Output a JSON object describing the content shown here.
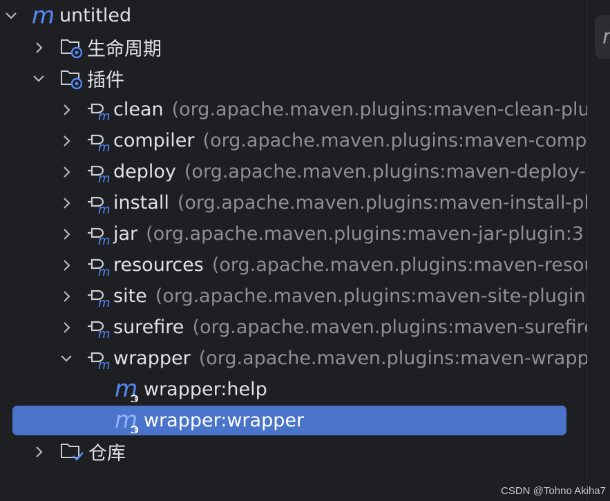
{
  "tree": {
    "root": {
      "label": "untitled",
      "expanded": true,
      "icon": "maven-module-icon"
    },
    "lifecycle": {
      "label": "生命周期",
      "expanded": false,
      "icon": "folder-settings-icon"
    },
    "plugins": {
      "label": "插件",
      "expanded": true,
      "icon": "folder-settings-icon",
      "items": [
        {
          "name": "clean",
          "coord": "(org.apache.maven.plugins:maven-clean-plugin"
        },
        {
          "name": "compiler",
          "coord": "(org.apache.maven.plugins:maven-compiler-plugin"
        },
        {
          "name": "deploy",
          "coord": "(org.apache.maven.plugins:maven-deploy-plugin"
        },
        {
          "name": "install",
          "coord": "(org.apache.maven.plugins:maven-install-plugin"
        },
        {
          "name": "jar",
          "coord": "(org.apache.maven.plugins:maven-jar-plugin:3"
        },
        {
          "name": "resources",
          "coord": "(org.apache.maven.plugins:maven-resources-plugin"
        },
        {
          "name": "site",
          "coord": "(org.apache.maven.plugins:maven-site-plugin"
        },
        {
          "name": "surefire",
          "coord": "(org.apache.maven.plugins:maven-surefire-plugin"
        },
        {
          "name": "wrapper",
          "coord": "(org.apache.maven.plugins:maven-wrapper-plugin"
        }
      ],
      "goals": [
        {
          "label": "wrapper:help",
          "selected": false
        },
        {
          "label": "wrapper:wrapper",
          "selected": true
        }
      ]
    },
    "repositories": {
      "label": "仓库",
      "expanded": false,
      "icon": "folder-check-icon"
    }
  },
  "side_tab": {
    "icon": "maven-tool-window-icon",
    "glyph": "m"
  },
  "watermark": "CSDN @Tohno Akiha7",
  "colors": {
    "background": "#1e1f22",
    "selection": "#4a74c9",
    "maven_blue": "#548af7",
    "muted_text": "#8c8f94"
  }
}
